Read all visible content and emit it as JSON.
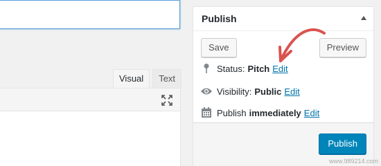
{
  "editor": {
    "tabs": [
      {
        "label": "Visual"
      },
      {
        "label": "Text"
      }
    ]
  },
  "publish_box": {
    "title": "Publish",
    "save_label": "Save",
    "preview_label": "Preview",
    "status": {
      "label": "Status:",
      "value": "Pitch",
      "edit": "Edit"
    },
    "visibility": {
      "label": "Visibility:",
      "value": "Public",
      "edit": "Edit"
    },
    "schedule": {
      "label": "Publish",
      "value": "immediately",
      "edit": "Edit"
    },
    "publish_label": "Publish"
  },
  "annotation": {
    "color": "#d9534f"
  },
  "watermark": "www.989214.com"
}
